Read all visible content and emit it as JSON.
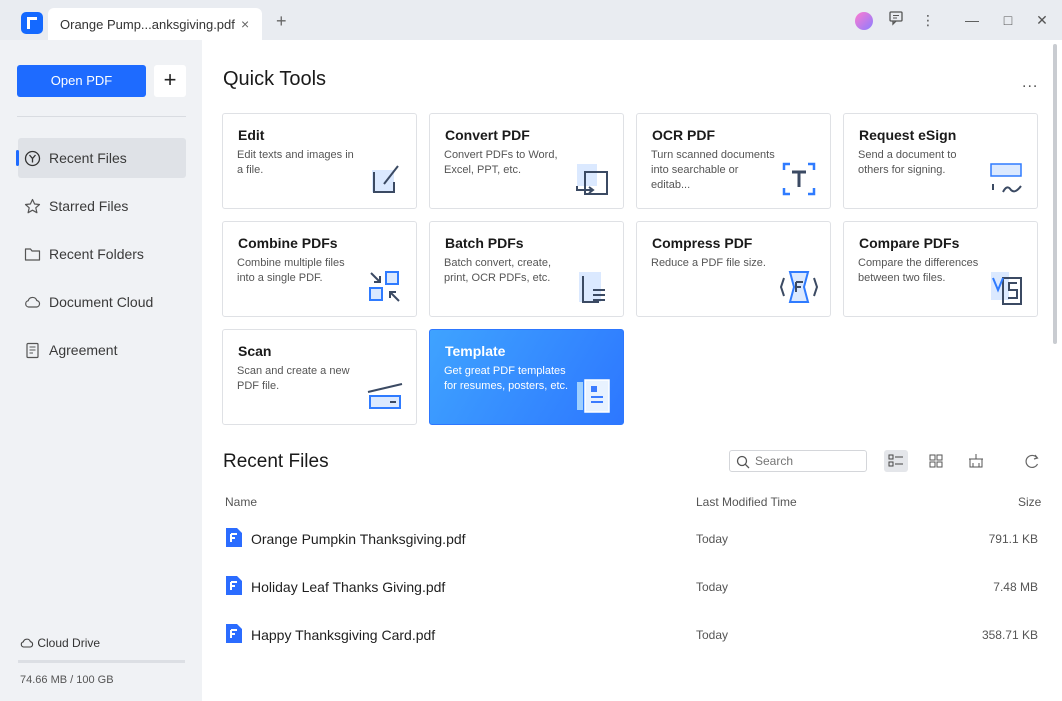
{
  "tab": {
    "title": "Orange Pump...anksgiving.pdf",
    "close": "×",
    "new": "+"
  },
  "window": {
    "more": "⋮",
    "min": "—",
    "max": "□",
    "close": "✕"
  },
  "sidebar": {
    "open_label": "Open PDF",
    "add_label": "+",
    "items": [
      {
        "label": "Recent Files",
        "icon": "recent-icon",
        "active": true
      },
      {
        "label": "Starred Files",
        "icon": "star-icon"
      },
      {
        "label": "Recent Folders",
        "icon": "folder-icon"
      },
      {
        "label": "Document Cloud",
        "icon": "cloud-icon"
      },
      {
        "label": "Agreement",
        "icon": "agreement-icon"
      }
    ],
    "cloud_label": "Cloud Drive",
    "storage": "74.66 MB / 100 GB"
  },
  "quick_tools": {
    "title": "Quick Tools",
    "more": "...",
    "cards": [
      {
        "title": "Edit",
        "desc": "Edit texts and images in a file."
      },
      {
        "title": "Convert PDF",
        "desc": "Convert PDFs to Word, Excel, PPT, etc."
      },
      {
        "title": "OCR PDF",
        "desc": "Turn scanned documents into searchable or editab..."
      },
      {
        "title": "Request eSign",
        "desc": "Send a document to others for signing."
      },
      {
        "title": "Combine PDFs",
        "desc": "Combine multiple files into a single PDF."
      },
      {
        "title": "Batch PDFs",
        "desc": "Batch convert, create, print, OCR PDFs, etc."
      },
      {
        "title": "Compress PDF",
        "desc": "Reduce a PDF file size."
      },
      {
        "title": "Compare PDFs",
        "desc": "Compare the differences between two files."
      },
      {
        "title": "Scan",
        "desc": "Scan and create a new PDF file."
      },
      {
        "title": "Template",
        "desc": "Get great PDF templates for resumes, posters, etc."
      }
    ]
  },
  "recent": {
    "title": "Recent Files",
    "search_placeholder": "Search",
    "columns": {
      "name": "Name",
      "modified": "Last Modified Time",
      "size": "Size"
    },
    "files": [
      {
        "name": "Orange Pumpkin Thanksgiving.pdf",
        "modified": "Today",
        "size": "791.1 KB"
      },
      {
        "name": "Holiday Leaf Thanks Giving.pdf",
        "modified": "Today",
        "size": "7.48 MB"
      },
      {
        "name": "Happy Thanksgiving Card.pdf",
        "modified": "Today",
        "size": "358.71 KB"
      }
    ]
  },
  "colors": {
    "accent": "#1e6bff",
    "sidebar_bg": "#f0f2f5",
    "titlebar_bg": "#e9ecf1"
  }
}
